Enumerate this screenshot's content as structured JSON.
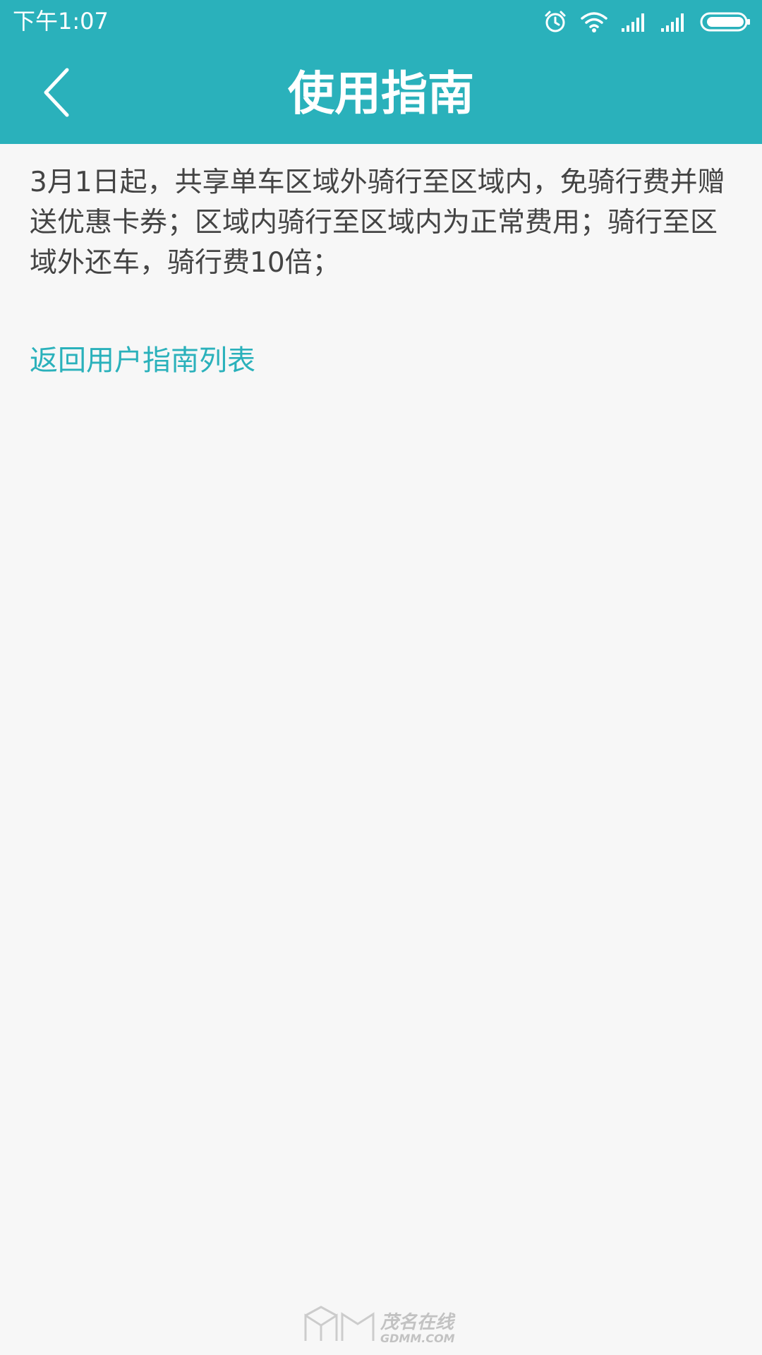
{
  "status_bar": {
    "time": "下午1:07",
    "icons": [
      "alarm-icon",
      "wifi-icon",
      "signal-icon",
      "signal-icon",
      "battery-icon"
    ]
  },
  "header": {
    "title": "使用指南",
    "back_icon": "chevron-left-icon"
  },
  "main": {
    "body_text": "3月1日起，共享单车区域外骑行至区域内，免骑行费并赠送优惠卡券；区域内骑行至区域内为正常费用；骑行至区域外还车，骑行费10倍；",
    "back_link": "返回用户指南列表"
  },
  "colors": {
    "accent": "#2ab1bb",
    "background": "#f7f7f7",
    "text": "#444444"
  }
}
